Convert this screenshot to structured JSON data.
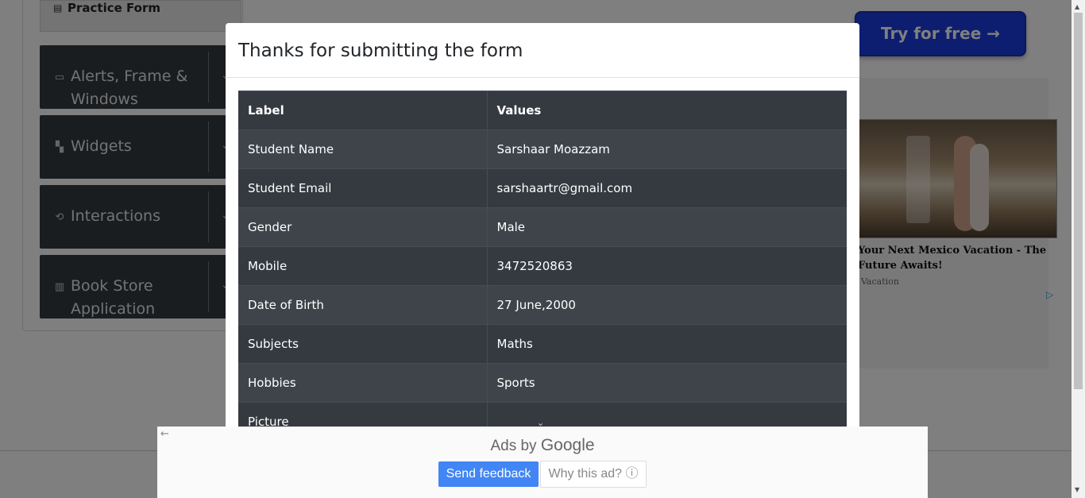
{
  "sidebar": {
    "current_item": "Practice Form",
    "groups": [
      {
        "label": "Alerts, Frame & Windows",
        "icon": "window-icon"
      },
      {
        "label": "Widgets",
        "icon": "widgets-icon"
      },
      {
        "label": "Interactions",
        "icon": "interactions-icon"
      },
      {
        "label": "Book Store Application",
        "icon": "book-icon"
      }
    ]
  },
  "right_ads": {
    "try_button": "Try for free →",
    "headline": "Your Next Mexico Vacation - The Future Awaits!",
    "source": "Vacation"
  },
  "modal": {
    "title": "Thanks for submitting the form",
    "table": {
      "headers": [
        "Label",
        "Values"
      ],
      "rows": [
        [
          "Student Name",
          "Sarshaar Moazzam"
        ],
        [
          "Student Email",
          "sarshaartr@gmail.com"
        ],
        [
          "Gender",
          "Male"
        ],
        [
          "Mobile",
          "3472520863"
        ],
        [
          "Date of Birth",
          "27 June,2000"
        ],
        [
          "Subjects",
          "Maths"
        ],
        [
          "Hobbies",
          "Sports"
        ],
        [
          "Picture",
          ""
        ]
      ]
    }
  },
  "ad_bar": {
    "ads_by": "Ads by",
    "google": "Google",
    "send_feedback": "Send feedback",
    "why_this_ad": "Why this ad? ⓘ"
  }
}
